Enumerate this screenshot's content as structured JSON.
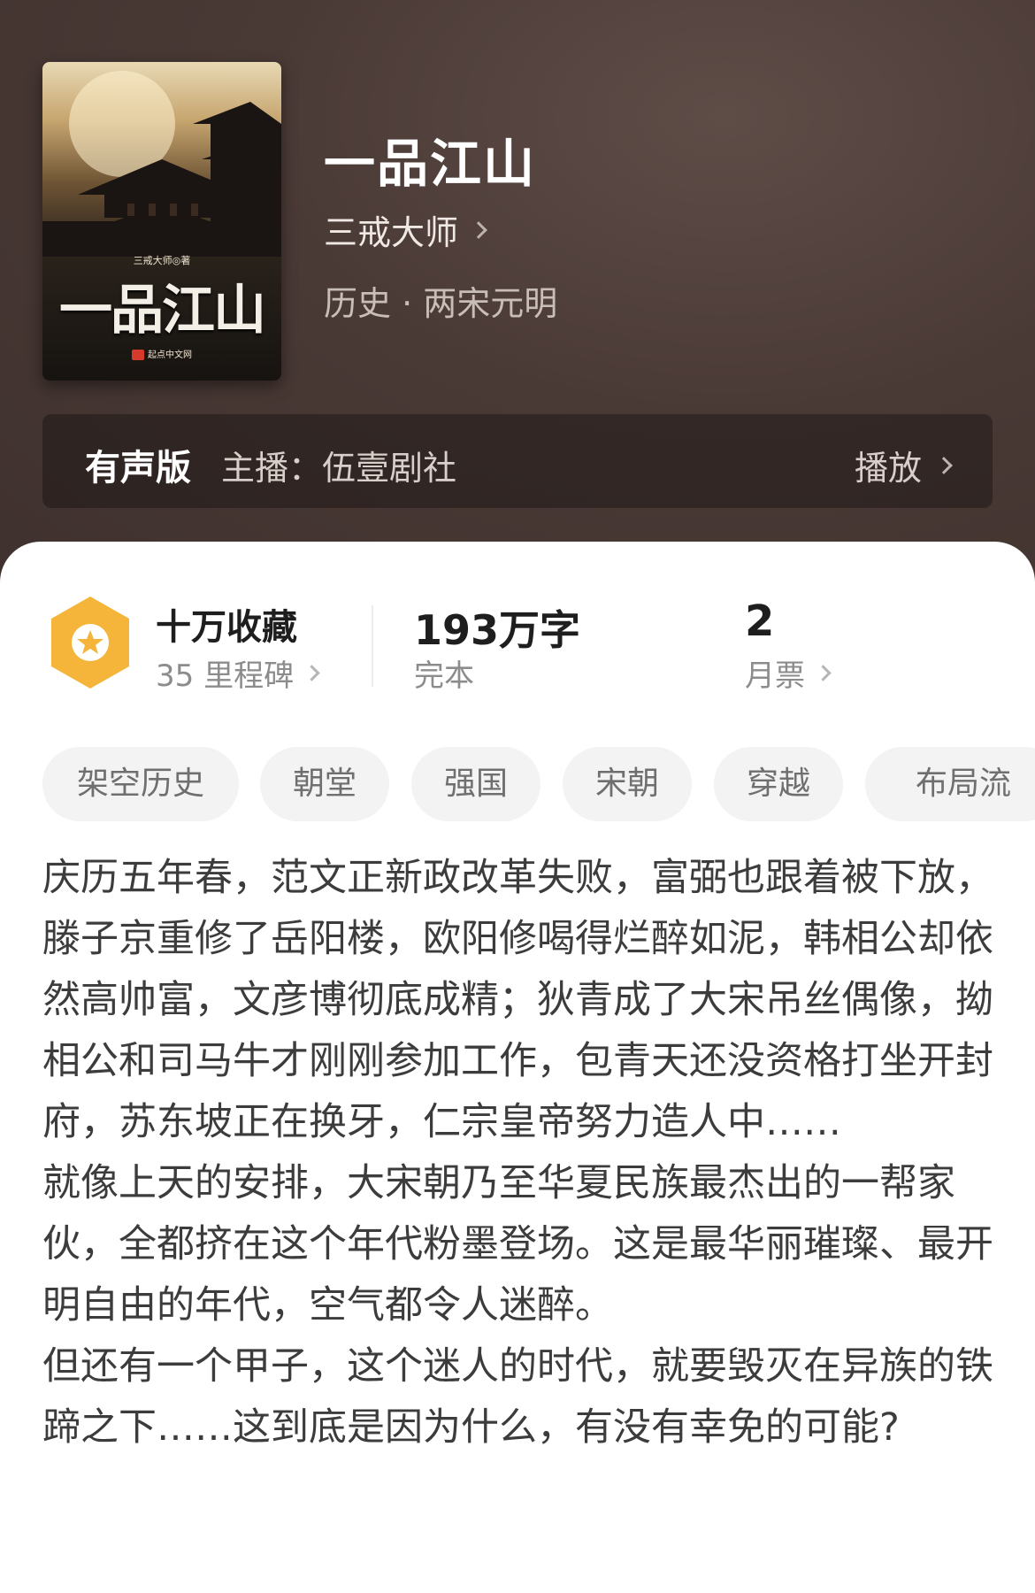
{
  "book": {
    "title": "一品江山",
    "author": "三戒大师",
    "genre": "历史 · 两宋元明",
    "cover": {
      "author_line": "三戒大师◎著",
      "title": "一品江山",
      "publisher": "起点中文网"
    }
  },
  "audio": {
    "label": "有声版",
    "host": "主播：伍壹剧社",
    "play": "播放"
  },
  "stats": {
    "favorites": "十万收藏",
    "milestones": "35 里程碑",
    "word_count": "193万字",
    "status": "完本",
    "monthly_votes": "2",
    "monthly_votes_label": "月票"
  },
  "tags": [
    "架空历史",
    "朝堂",
    "强国",
    "宋朝",
    "穿越",
    "布局流"
  ],
  "synopsis": [
    "庆历五年春，范文正新政改革失败，富弼也跟着被下放，滕子京重修了岳阳楼，欧阳修喝得烂醉如泥，韩相公却依然高帅富，文彦博彻底成精；狄青成了大宋吊丝偶像，拗相公和司马牛才刚刚参加工作，包青天还没资格打坐开封府，苏东坡正在换牙，仁宗皇帝努力造人中……",
    "就像上天的安排，大宋朝乃至华夏民族最杰出的一帮家伙，全都挤在这个年代粉墨登场。这是最华丽璀璨、最开明自由的年代，空气都令人迷醉。",
    "但还有一个甲子，这个迷人的时代，就要毁灭在异族的铁蹄之下……这到底是因为什么，有没有幸免的可能?"
  ],
  "colors": {
    "header_bg": "#4a3a36",
    "badge": "#f5b43a",
    "tag_bg": "#f3f3f3"
  }
}
